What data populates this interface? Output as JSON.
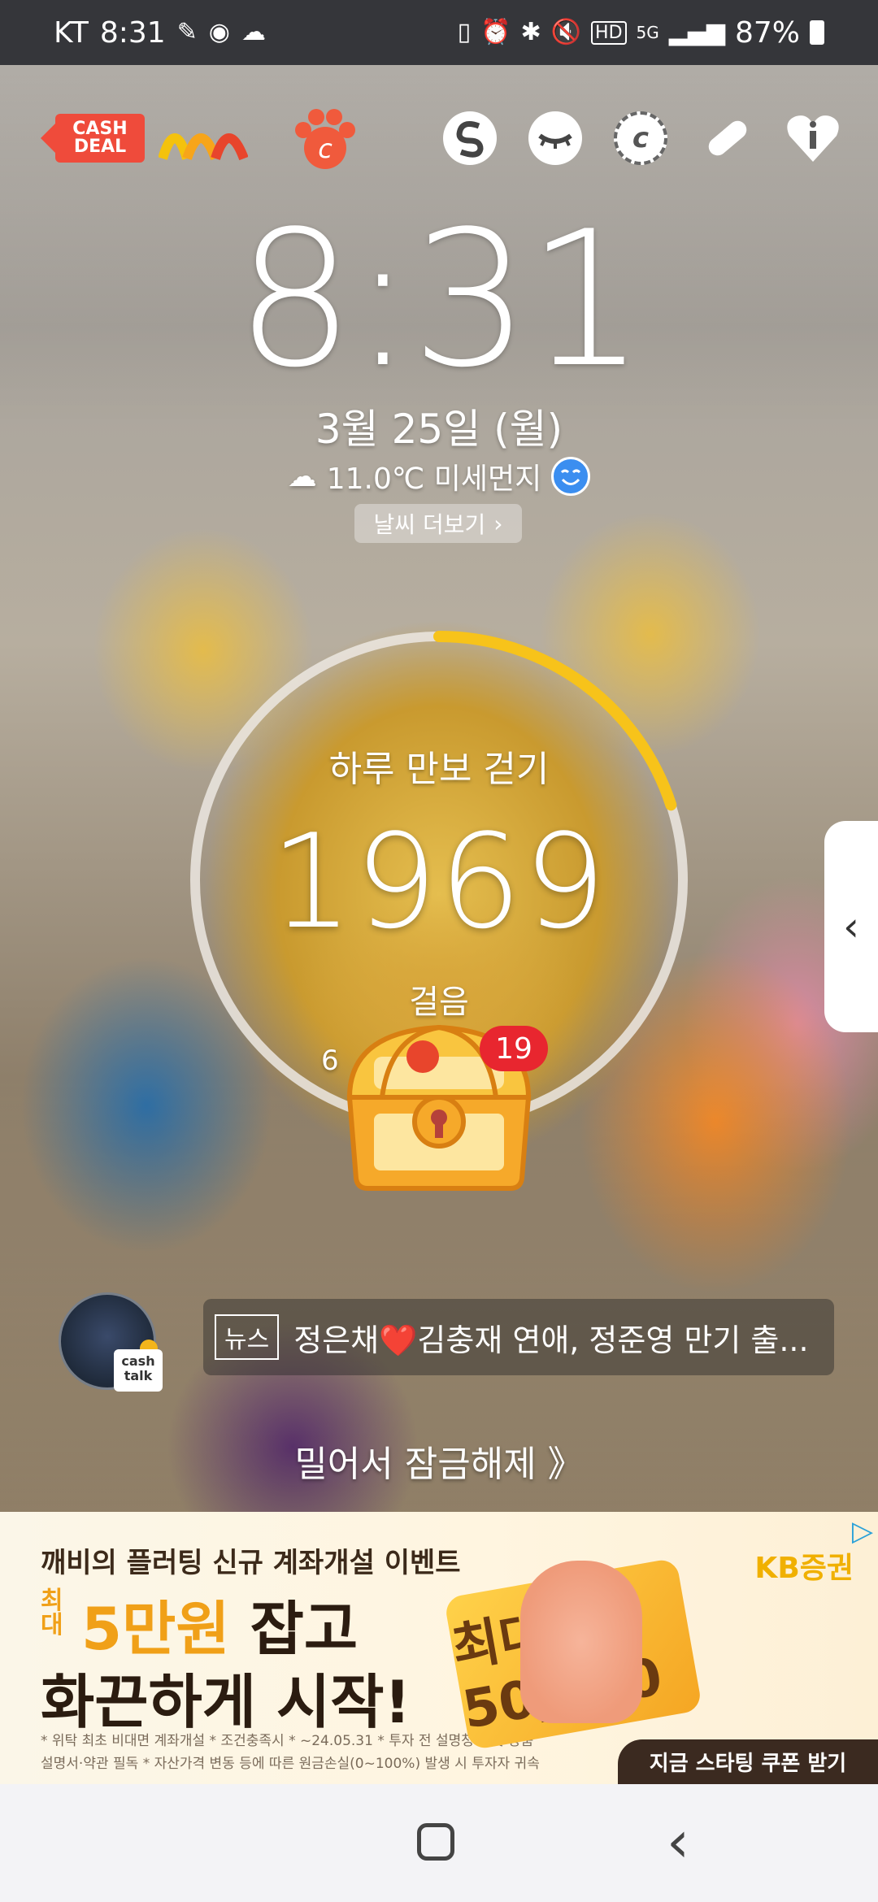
{
  "status_bar": {
    "carrier": "KT",
    "time": "8:31",
    "battery": "87%",
    "network": "5G",
    "hd": "HD",
    "colors": {
      "background": "#35363a",
      "text": "#ffffff"
    }
  },
  "top_apps": [
    {
      "name": "cash-deal",
      "label": "CASH DEAL"
    },
    {
      "name": "rainbow-app",
      "label": ""
    },
    {
      "name": "paw-c-app",
      "label": "c"
    },
    {
      "name": "s-app",
      "label": ""
    },
    {
      "name": "eye-mask-app",
      "label": ""
    },
    {
      "name": "c-coin-app",
      "label": "c"
    },
    {
      "name": "pill-app",
      "label": ""
    },
    {
      "name": "heart-info-app",
      "label": ""
    }
  ],
  "lockscreen": {
    "clock": "8:31",
    "date": "3월 25일 (월)",
    "weather_text": "11.0℃ 미세먼지",
    "weather_more": "날씨 더보기"
  },
  "steps": {
    "title": "하루 만보 걷기",
    "count": "1969",
    "unit": "걸음",
    "sub_visible": "6",
    "sub_suffix": "l",
    "progress_fraction": 0.2,
    "colors": {
      "track": "#e8e4de",
      "progress": "#f7c31a"
    }
  },
  "chest": {
    "badge": "19"
  },
  "cashtalk": {
    "tag": "cash talk"
  },
  "news": {
    "tag": "뉴스",
    "headline": "정은채❤️김충재 연애, 정준영 만기 출..."
  },
  "unlock": {
    "label": "밀어서 잠금해제 》"
  },
  "ad": {
    "headline": "깨비의 플러팅 신규 계좌개설 이벤트",
    "small_label": "최대",
    "big_line1_accent": "5만원",
    "big_line1_rest": " 잡고",
    "big_line2": "화끈하게 시작!",
    "fine_print_1": "* 위탁 최초 비대면 계좌개설 * 조건충족시 * ~24.05.31 * 투자 전 설명청취 및 상품",
    "fine_print_2": "설명서·약관 필독 * 자산가격 변동 등에 따른 원금손실(0~100%) 발생 시 투자자 귀속",
    "card_text": "최대50,000",
    "brand": "KB증권",
    "cta": "지금 스타팅 쿠폰 받기"
  }
}
